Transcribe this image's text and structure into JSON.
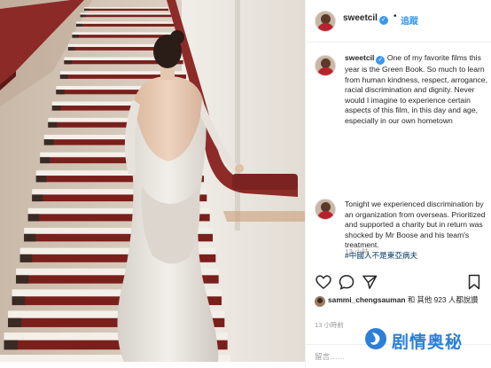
{
  "post": {
    "username": "sweetcil",
    "verified_mark": "✓",
    "dot": "•",
    "follow_label": "追蹤"
  },
  "caption": {
    "username": "sweetcil",
    "paragraph_1": "One of my favorite films this year is the Green Book. So much to learn from human kindness, respect, arrogance, racial discrimination and dignity. Never would I imagine to experience certain aspects of this film, in this day and age, especially in our own hometown",
    "paragraph_2": "Tonight we experienced discrimination by an organization from overseas. Prioritized and supported a charity but in return was shocked by Mr Boose and his team's treatment.",
    "hashtag": "#中國人不是東亞病夫",
    "time": "13 小時"
  },
  "actions": {
    "like_icon": "heart-icon",
    "comment_icon": "comment-bubble-icon",
    "share_icon": "share-arrow-icon",
    "save_icon": "bookmark-icon"
  },
  "likes": {
    "user": "sammi_chengsauman",
    "text": " 和 其他 923 人都說讚"
  },
  "post_time": "13 小時前",
  "comment": {
    "placeholder": "留言……"
  },
  "watermark": {
    "text": "剧情奥秘",
    "color": "#2c7fd8"
  },
  "colors": {
    "accent": "#3897f0",
    "dress": "#e6e2dc",
    "carpet": "#7a1f1c"
  }
}
